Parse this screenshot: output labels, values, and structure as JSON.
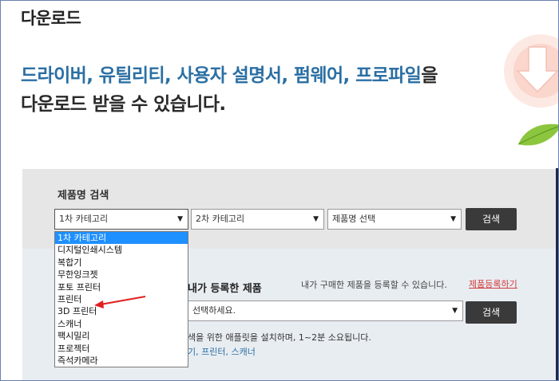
{
  "page": {
    "title": "다운로드",
    "hero_line1_blue": "드라이버, 유틸리티, 사용자 설명서, 펌웨어, 프로파일",
    "hero_line1_tail": "을",
    "hero_line2": "다운로드 받을 수 있습니다."
  },
  "search": {
    "label": "제품명 검색",
    "category1": "1차 카테고리",
    "category2": "2차 카테고리",
    "product": "제품명 선택",
    "button": "검색"
  },
  "dropdown": {
    "options": [
      "1차 카테고리",
      "디지털인쇄시스템",
      "복합기",
      "무한잉크젯",
      "포토 프린터",
      "프린터",
      "3D 프린터",
      "스캐너",
      "팩시밀리",
      "프로젝터",
      "즉석카메라"
    ],
    "selected_index": 0
  },
  "registered": {
    "title": "내가 등록한 제품",
    "desc": "내가 구매한 제품을 등록할 수 있습니다.",
    "link": "제품등록하기",
    "select": "선택하세요.",
    "button": "검색",
    "install_text": "색을 위한 애플릿을 설치하며, 1~2분 소요됩니다.",
    "links": "기, 프린터, 스캐너"
  },
  "colors": {
    "accent_blue": "#2b6fa3",
    "selected_option": "#1e90ff",
    "annotation_arrow": "#e02020",
    "button": "#3a3a3a"
  }
}
